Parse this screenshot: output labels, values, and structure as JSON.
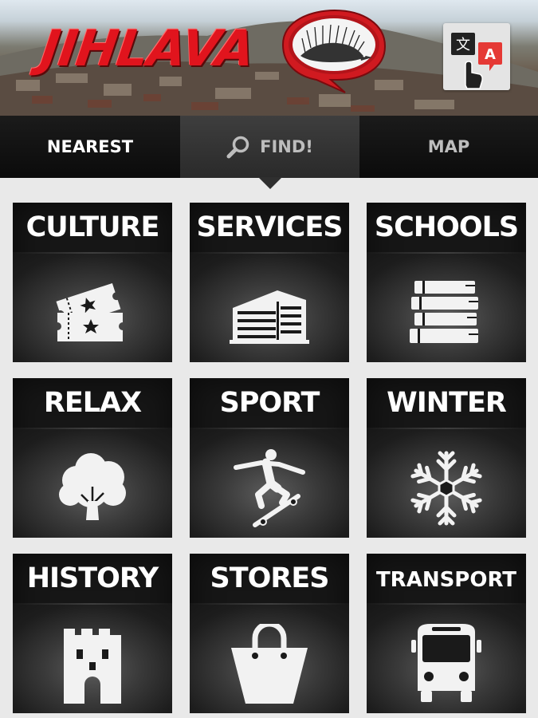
{
  "header": {
    "title": "JIHLAVA",
    "logo_icon": "hedgehog-speech-bubble-icon",
    "translate_icon": "translate-icon"
  },
  "tabs": [
    {
      "label": "NEAREST",
      "active": false
    },
    {
      "label": "FIND!",
      "active": true,
      "icon": "search-icon"
    },
    {
      "label": "MAP",
      "active": false
    }
  ],
  "categories": [
    {
      "label": "CULTURE",
      "icon": "tickets-icon"
    },
    {
      "label": "SERVICES",
      "icon": "building-icon"
    },
    {
      "label": "SCHOOLS",
      "icon": "books-icon"
    },
    {
      "label": "RELAX",
      "icon": "tree-icon"
    },
    {
      "label": "SPORT",
      "icon": "skateboarder-icon"
    },
    {
      "label": "WINTER",
      "icon": "snowflake-icon"
    },
    {
      "label": "HISTORY",
      "icon": "castle-tower-icon"
    },
    {
      "label": "STORES",
      "icon": "shopping-bag-icon"
    },
    {
      "label": "TRANSPORT",
      "icon": "bus-icon"
    }
  ],
  "colors": {
    "title_red": "#e1141d",
    "tile_bg": "#161616",
    "tab_bar": "#0b0b0b",
    "page_bg": "#e9e9e9"
  }
}
